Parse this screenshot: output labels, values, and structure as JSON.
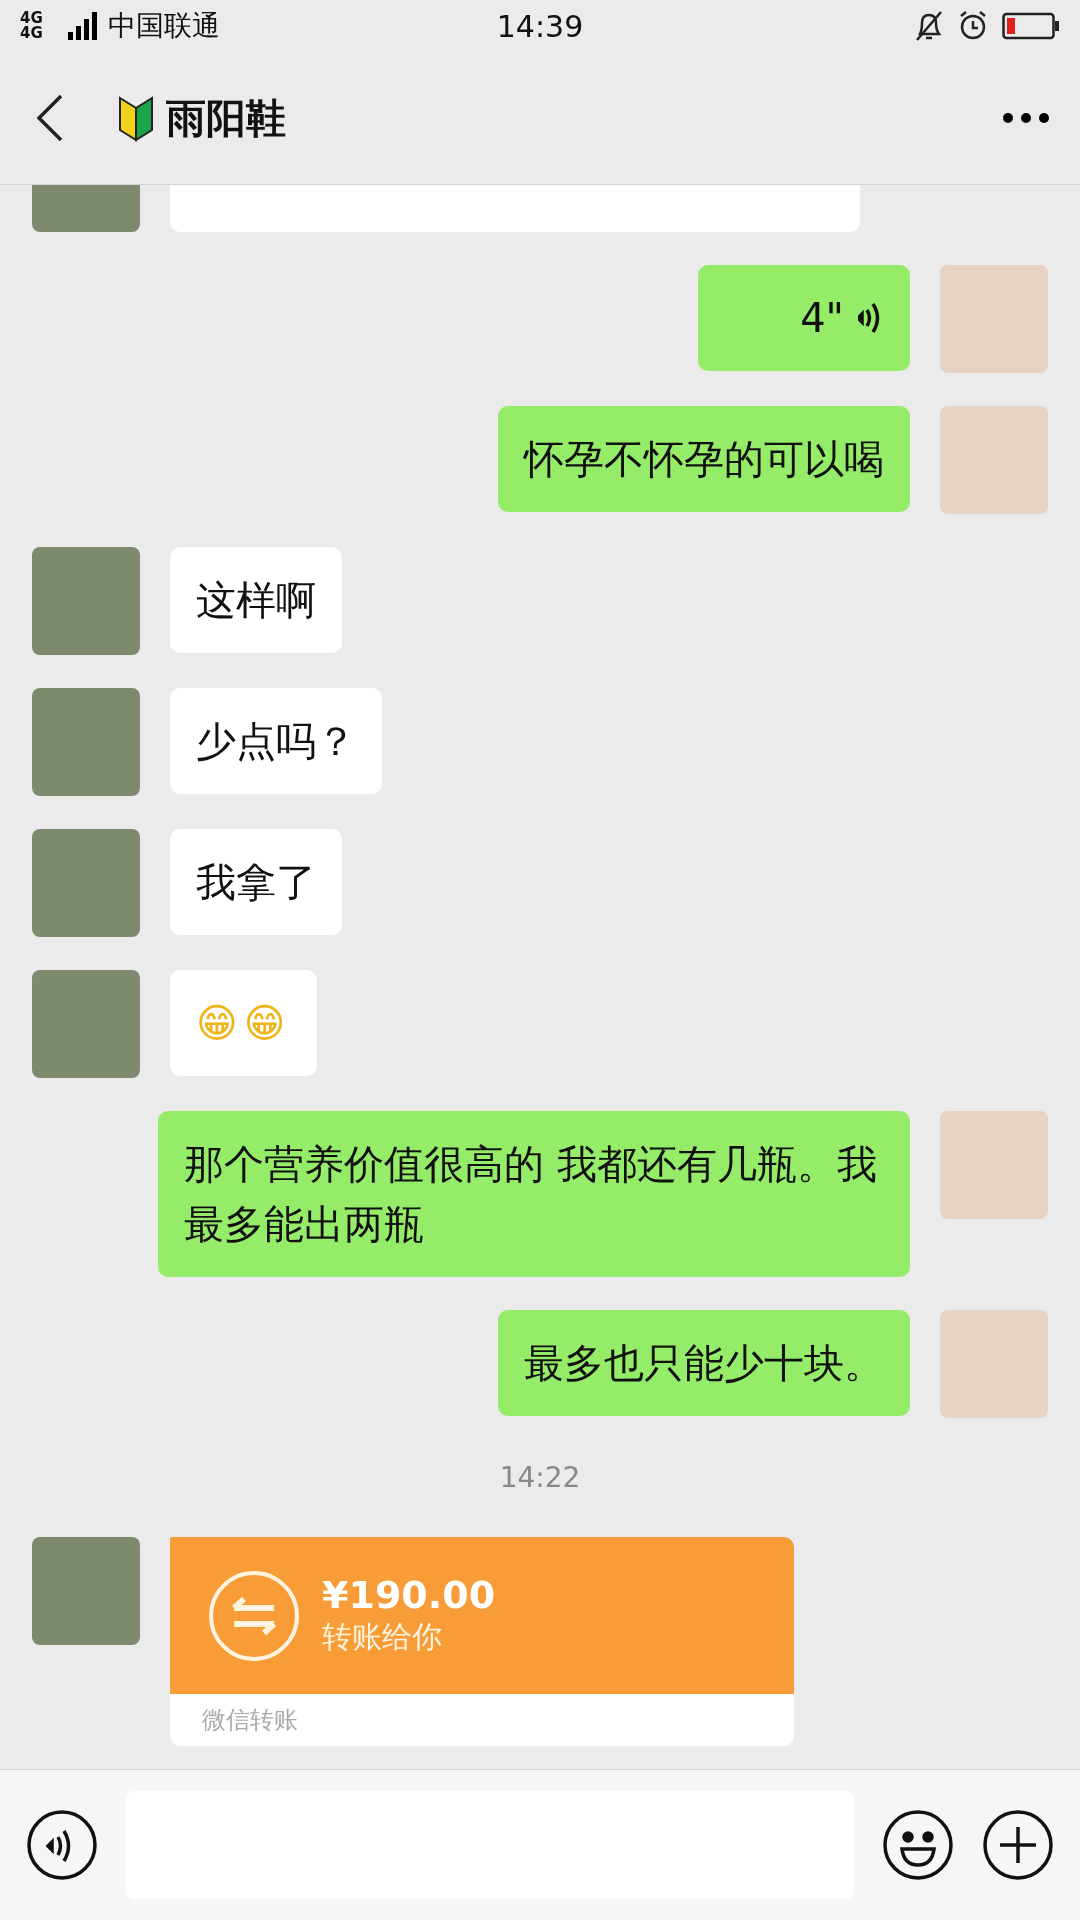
{
  "status_bar": {
    "network": "4G 4G",
    "carrier": "中国联通",
    "time": "14:39"
  },
  "header": {
    "title": "雨阳鞋"
  },
  "messages": [
    {
      "kind": "cut",
      "outgoing": false
    },
    {
      "kind": "voice",
      "outgoing": true,
      "text": "4\""
    },
    {
      "kind": "text",
      "outgoing": true,
      "text": "怀孕不怀孕的可以喝"
    },
    {
      "kind": "text",
      "outgoing": false,
      "text": "这样啊"
    },
    {
      "kind": "text",
      "outgoing": false,
      "text": "少点吗？"
    },
    {
      "kind": "text",
      "outgoing": false,
      "text": "我拿了"
    },
    {
      "kind": "emoji",
      "outgoing": false,
      "text": "😁😁"
    },
    {
      "kind": "text",
      "outgoing": true,
      "text": "那个营养价值很高的  我都还有几瓶。我最多能出两瓶"
    },
    {
      "kind": "text",
      "outgoing": true,
      "text": "最多也只能少十块。"
    },
    {
      "kind": "time",
      "text": "14:22"
    },
    {
      "kind": "transfer",
      "outgoing": false,
      "amount": "¥190.00",
      "note": "转账给你",
      "footer": "微信转账"
    }
  ]
}
